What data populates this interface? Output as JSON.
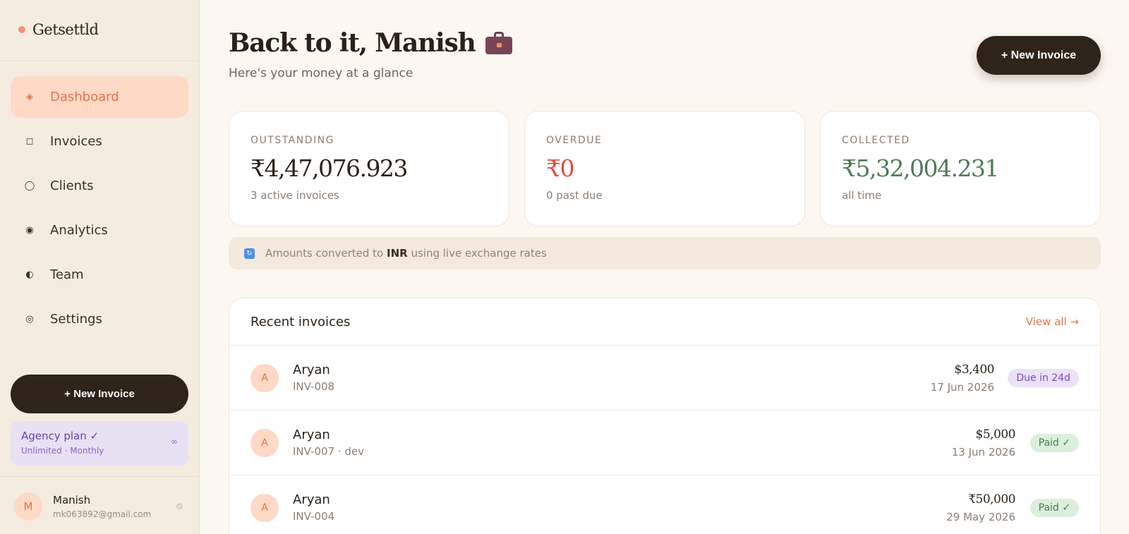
{
  "brand": {
    "name": "Getsettld"
  },
  "sidebar": {
    "items": [
      {
        "label": "Dashboard",
        "icon": "diamond-icon",
        "glyph": "◈",
        "active": true
      },
      {
        "label": "Invoices",
        "icon": "square-icon",
        "glyph": "◻",
        "active": false
      },
      {
        "label": "Clients",
        "icon": "circle-icon",
        "glyph": "◯",
        "active": false
      },
      {
        "label": "Analytics",
        "icon": "target-icon",
        "glyph": "◉",
        "active": false
      },
      {
        "label": "Team",
        "icon": "half-circle-icon",
        "glyph": "◐",
        "active": false
      },
      {
        "label": "Settings",
        "icon": "concentric-circle-icon",
        "glyph": "◎",
        "active": false
      }
    ],
    "new_invoice_label": "+ New Invoice",
    "plan": {
      "title": "Agency plan ✓",
      "subtitle": "Unlimited · Monthly",
      "limit": "∞"
    },
    "user": {
      "initial": "M",
      "name": "Manish",
      "email": "mk063892@gmail.com",
      "logout_icon": "⦸"
    }
  },
  "header": {
    "title": "Back to it, Manish",
    "title_icon": "briefcase-icon",
    "subtitle": "Here's your money at a glance",
    "new_invoice_label": "+ New Invoice"
  },
  "stats": [
    {
      "label": "OUTSTANDING",
      "value": "₹4,47,076.923",
      "sub": "3 active invoices",
      "color": "#2b2118"
    },
    {
      "label": "OVERDUE",
      "value": "₹0",
      "sub": "0 past due",
      "color": "#e5483a"
    },
    {
      "label": "COLLECTED",
      "value": "₹5,32,004.231",
      "sub": "all time",
      "color": "#4f7a55"
    }
  ],
  "fx": {
    "prefix": "Amounts converted to",
    "currency": "INR",
    "suffix": "using live exchange rates",
    "icon": "refresh-icon"
  },
  "recent": {
    "title": "Recent invoices",
    "view_all": "View all →",
    "rows": [
      {
        "initial": "A",
        "name": "Aryan",
        "id": "INV-008",
        "amount": "$3,400",
        "date": "17 Jun 2026",
        "status": "Due in 24d",
        "status_type": "due"
      },
      {
        "initial": "A",
        "name": "Aryan",
        "id": "INV-007 · dev",
        "amount": "$5,000",
        "date": "13 Jun 2026",
        "status": "Paid ✓",
        "status_type": "paid"
      },
      {
        "initial": "A",
        "name": "Aryan",
        "id": "INV-004",
        "amount": "₹50,000",
        "date": "29 May 2026",
        "status": "Paid ✓",
        "status_type": "paid"
      }
    ]
  },
  "colors": {
    "accent": "#e4744a",
    "dark": "#2e2419",
    "overdue": "#e5483a",
    "collected": "#4f7a55"
  }
}
